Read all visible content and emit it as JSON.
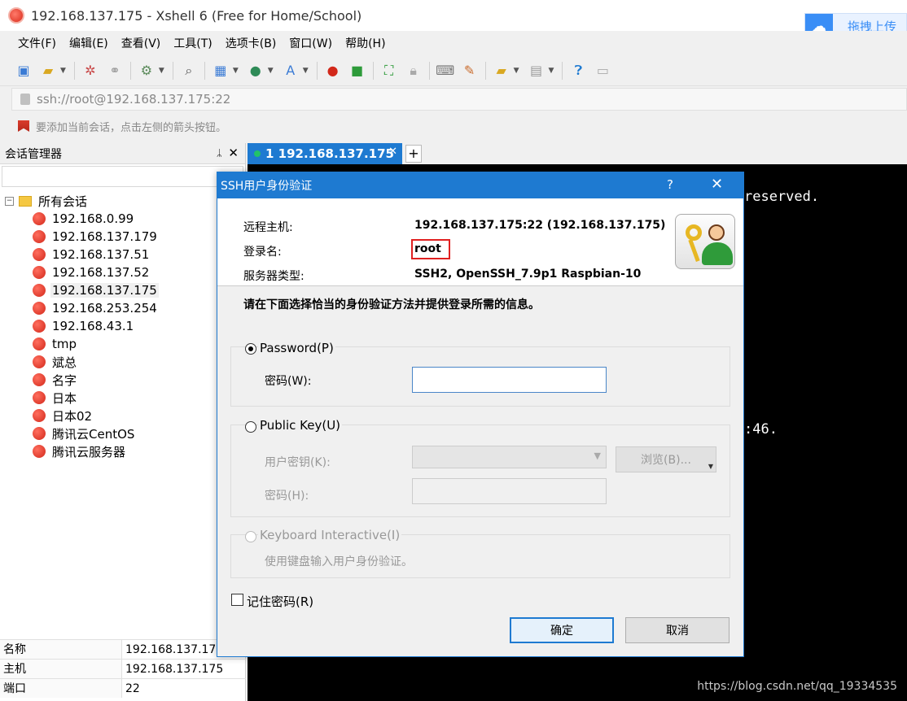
{
  "window": {
    "title": "192.168.137.175 - Xshell 6 (Free for Home/School)"
  },
  "upload": {
    "label": "拖拽上传"
  },
  "menu": [
    "文件(F)",
    "编辑(E)",
    "查看(V)",
    "工具(T)",
    "选项卡(B)",
    "窗口(W)",
    "帮助(H)"
  ],
  "address": {
    "value": "ssh://root@192.168.137.175:22"
  },
  "hint": {
    "text": "要添加当前会话，点击左侧的箭头按钮。"
  },
  "session_manager": {
    "title": "会话管理器",
    "pin": "ᛦ",
    "close": "✕",
    "root_label": "所有会话",
    "items": [
      "192.168.0.99",
      "192.168.137.179",
      "192.168.137.51",
      "192.168.137.52",
      "192.168.137.175",
      "192.168.253.254",
      "192.168.43.1",
      "tmp",
      "斌总",
      "名字",
      "日本",
      "日本02",
      "腾讯云CentOS",
      "腾讯云服务器"
    ],
    "selected": "192.168.137.175",
    "properties": [
      {
        "key": "名称",
        "value": "192.168.137.17"
      },
      {
        "key": "主机",
        "value": "192.168.137.175"
      },
      {
        "key": "端口",
        "value": "22"
      }
    ]
  },
  "tab": {
    "index": "1",
    "label": "1 192.168.137.175",
    "close": "✕",
    "add": "+"
  },
  "terminal": {
    "line1": "reserved.",
    "line2": ":46."
  },
  "watermark": "https://blog.csdn.net/qq_19334535",
  "dialog": {
    "title": "SSH用户身份验证",
    "help": "?",
    "close": "✕",
    "remote_host_label": "远程主机:",
    "remote_host_value": "192.168.137.175:22 (192.168.137.175)",
    "login_label": "登录名:",
    "login_value": "root",
    "server_type_label": "服务器类型:",
    "server_type_value": "SSH2, OpenSSH_7.9p1 Raspbian-10",
    "instruction": "请在下面选择恰当的身份验证方法并提供登录所需的信息。",
    "password_option": "Password(P)",
    "password_label": "密码(W):",
    "password_value": "",
    "pubkey_option": "Public Key(U)",
    "user_key_label": "用户密钥(K):",
    "browse_label": "浏览(B)...",
    "pubkey_password_label": "密码(H):",
    "keyboard_option": "Keyboard Interactive(I)",
    "keyboard_desc": "使用键盘输入用户身份验证。",
    "remember_label": "记住密码(R)",
    "ok_label": "确定",
    "cancel_label": "取消"
  },
  "colors": {
    "accent": "#1e7ad1",
    "highlight": "#e02020"
  }
}
